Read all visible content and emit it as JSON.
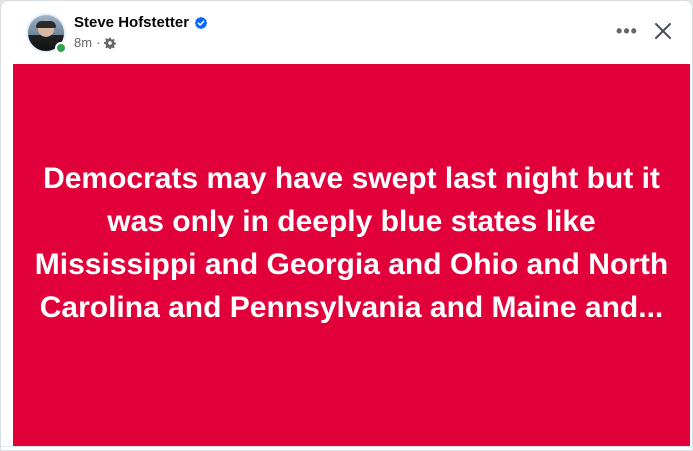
{
  "post": {
    "author": "Steve Hofstetter",
    "timestamp": "8m",
    "separator": "·",
    "verified_icon": "verified-badge-icon",
    "audience_icon": "gear-icon",
    "background_color": "#e2003a",
    "text": "Democrats may have swept last night but it was only in deeply blue states like Mississippi and Georgia and Ohio and North Carolina and Pennsylvania and Maine and..."
  },
  "header_actions": {
    "more_label": "•••",
    "close_icon": "close-icon"
  },
  "colors": {
    "verified_blue": "#0866ff",
    "online_green": "#31a24c",
    "secondary_text": "#65676b"
  }
}
